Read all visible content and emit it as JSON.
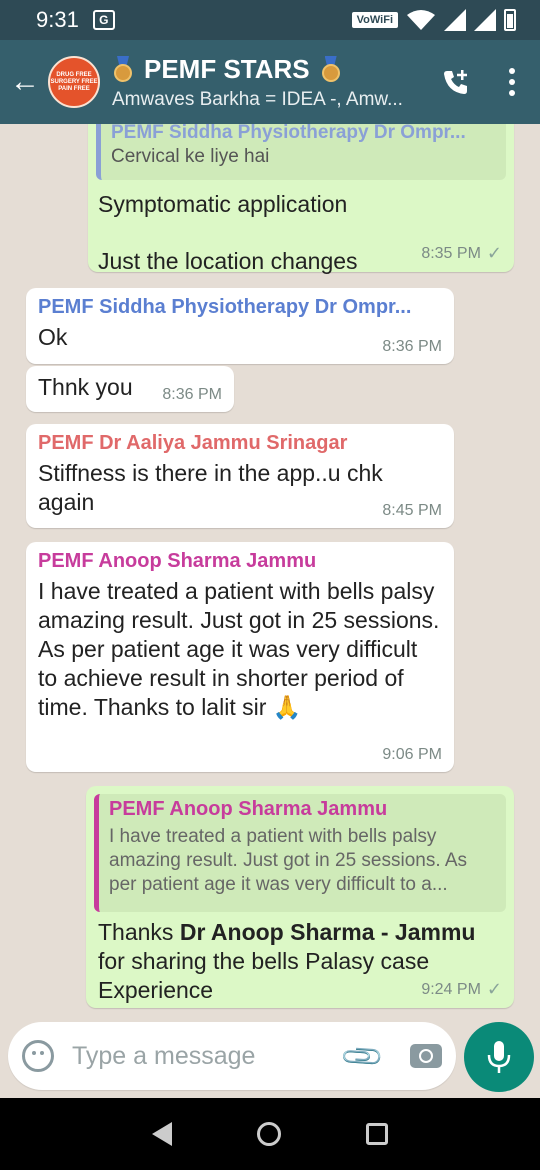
{
  "status_bar": {
    "time": "9:31",
    "vowifi": "VoWiFi"
  },
  "header": {
    "title": "PEMF STARS",
    "subtitle": "Amwaves Barkha = IDEA -, Amw...",
    "avatar_text": "DRUG FREE SURGERY FREE PAIN FREE"
  },
  "messages": [
    {
      "type": "out",
      "quote_sender": "PEMF Siddha Physiotherapy Dr Ompr...",
      "quote_text": "Cervical ke liye hai",
      "text_line1": "Symptomatic application",
      "text_line2": "Just the location changes",
      "time": "8:35 PM"
    },
    {
      "type": "in",
      "sender": "PEMF Siddha Physiotherapy Dr Ompr...",
      "sender_color": "#5b7fd1",
      "text": "Ok",
      "time": "8:36 PM"
    },
    {
      "type": "in",
      "text": "Thnk you",
      "time": "8:36 PM"
    },
    {
      "type": "in",
      "sender": "PEMF Dr Aaliya Jammu Srinagar",
      "sender_color": "#e0696a",
      "text": "Stiffness is there in the app..u chk again",
      "time": "8:45 PM"
    },
    {
      "type": "in",
      "sender": "PEMF Anoop Sharma Jammu",
      "sender_color": "#c73c9c",
      "text": "I have treated a patient with bells palsy amazing result. Just got in 25 sessions. As per patient age it was very difficult to achieve result in shorter period of time. Thanks to lalit sir",
      "emoji": "🙏",
      "time": "9:06 PM"
    },
    {
      "type": "out",
      "quote_sender": "PEMF Anoop Sharma Jammu",
      "quote_text": "I have treated a patient with bells palsy amazing result. Just got in 25 sessions. As per patient age it was very difficult to a...",
      "text_prefix": "Thanks ",
      "text_bold": "Dr Anoop Sharma -  Jammu",
      "text_suffix": " for sharing the bells Palasy case Experience",
      "time": "9:24 PM"
    }
  ],
  "composer": {
    "placeholder": "Type a message"
  },
  "colors": {
    "header": "#355f6c",
    "out_bubble": "#dcf8c6",
    "in_bubble": "#ffffff",
    "mic": "#0a8a78"
  }
}
